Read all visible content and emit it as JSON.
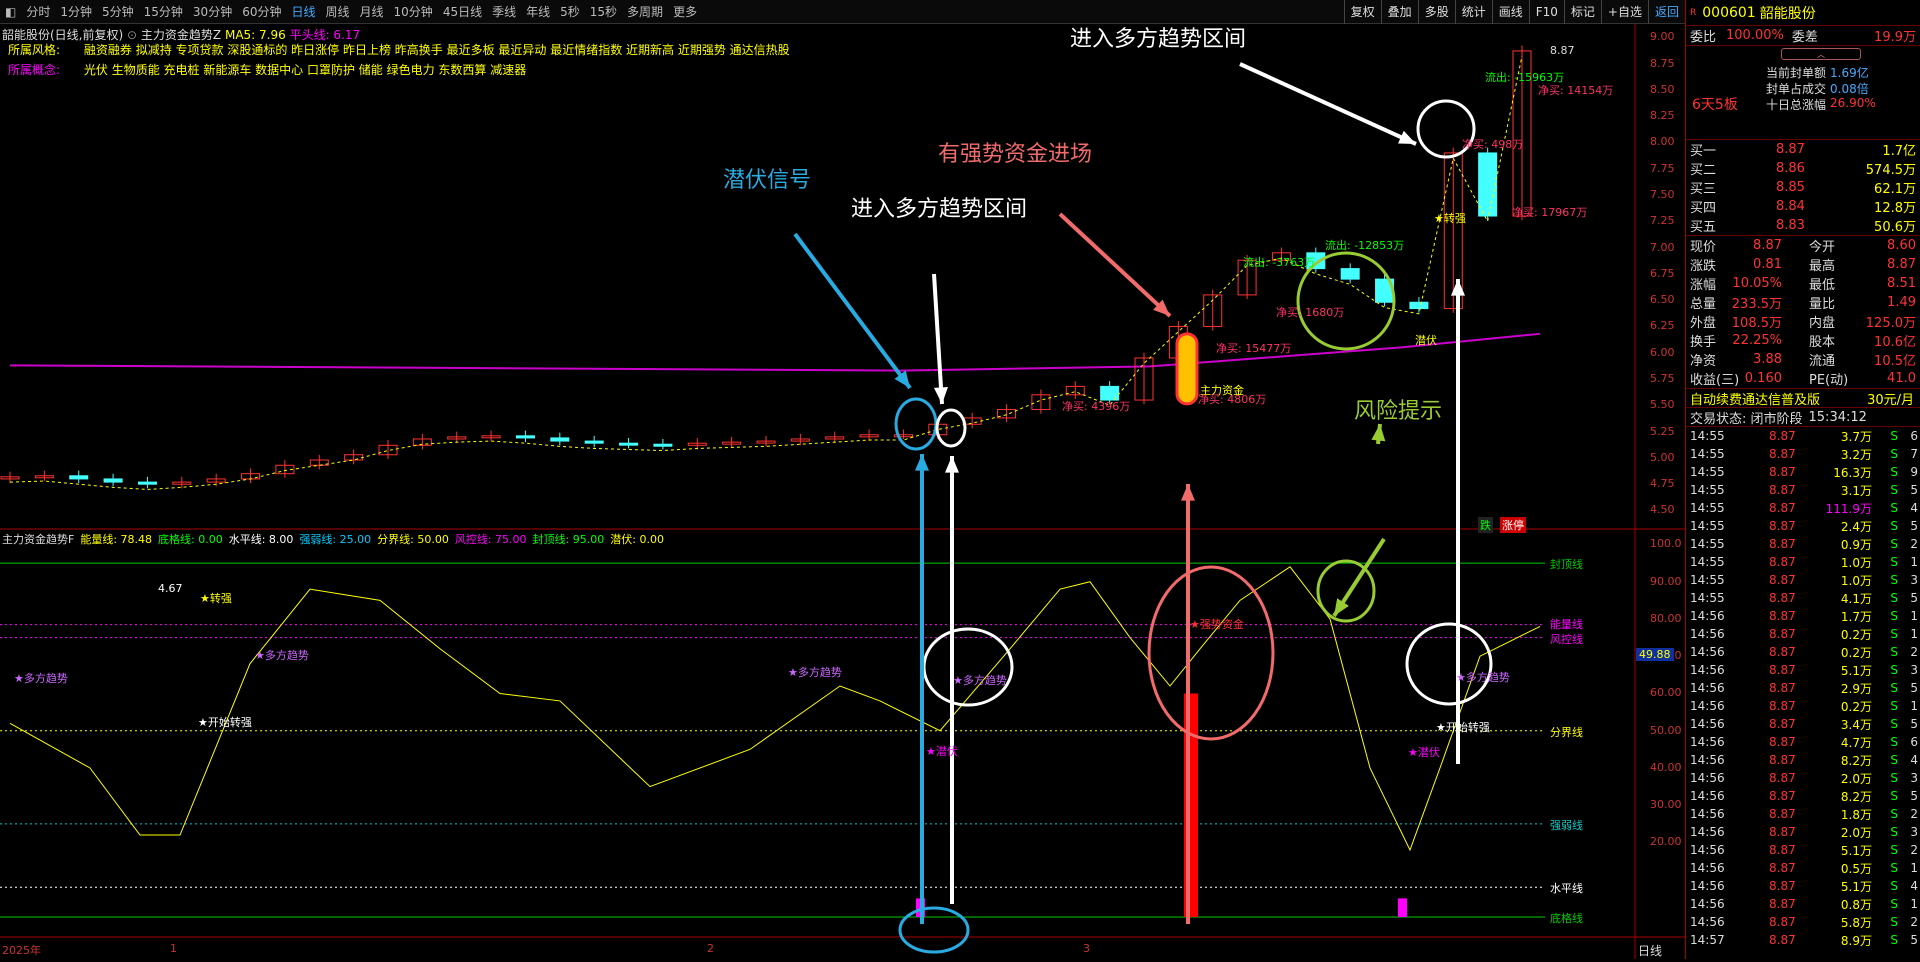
{
  "periods": [
    "分时",
    "1分钟",
    "5分钟",
    "15分钟",
    "30分钟",
    "60分钟",
    "日线",
    "周线",
    "月线",
    "10分钟",
    "45日线",
    "季线",
    "年线",
    "5秒",
    "15秒",
    "多周期",
    "更多"
  ],
  "active_period": "日线",
  "tools": [
    "复权",
    "叠加",
    "多股",
    "统计",
    "画线",
    "F10",
    "标记",
    "+自选",
    "返回"
  ],
  "main_title": "韶能股份(日线,前复权)",
  "main_indicator": "主力资金趋势Z",
  "ma5": "MA5: 7.96",
  "pingtou": "平头线: 6.17",
  "style_label": "所属风格:",
  "style_value": "融资融券 拟减持 专项贷款 深股通标的 昨日涨停 昨日上榜 昨高换手 最近多板 最近异动 最近情绪指数 近期新高 近期强势 通达信热股",
  "concept_label": "所属概念:",
  "concept_value": "光伏 生物质能 充电桩 新能源车 数据中心 口罩防护 储能 绿色电力 东数西算 减速器",
  "y_ticks_main": [
    "9.00",
    "8.75",
    "8.50",
    "8.25",
    "8.00",
    "7.75",
    "7.50",
    "7.25",
    "7.00",
    "6.75",
    "6.50",
    "6.25",
    "6.00",
    "5.75",
    "5.50",
    "5.25",
    "5.00",
    "4.75",
    "4.50"
  ],
  "y_ticks_sub": [
    "100.0",
    "90.00",
    "80.00",
    "70.00",
    "60.00",
    "50.00",
    "40.00",
    "30.00",
    "20.00"
  ],
  "sub_value_tag": "49.88",
  "sub_legend": [
    {
      "t": "主力资金趋势F",
      "c": "#ddd"
    },
    {
      "t": "能量线: 78.48",
      "c": "#ff0"
    },
    {
      "t": "底格线: 0.00",
      "c": "#0f0"
    },
    {
      "t": "水平线: 8.00",
      "c": "#fff"
    },
    {
      "t": "强弱线: 25.00",
      "c": "#0cf"
    },
    {
      "t": "分界线: 50.00",
      "c": "#ff0"
    },
    {
      "t": "风控线: 75.00",
      "c": "#f0f"
    },
    {
      "t": "封顶线: 95.00",
      "c": "#0f0"
    },
    {
      "t": "潜伏: 0.00",
      "c": "#ff0"
    }
  ],
  "sub_line_labels": [
    "封顶线",
    "能量线",
    "风控线",
    "分界线",
    "强弱线",
    "水平线",
    "底格线"
  ],
  "x_axis": [
    "2025年",
    "1",
    "2",
    "3"
  ],
  "x_axis_right": "日线",
  "annotations": [
    "进入多方趋势区间",
    "潜伏信号",
    "进入多方趋势区间",
    "有强势资金进场",
    "风险提示"
  ],
  "main_labels": [
    "4.67",
    "★转强",
    "★转强",
    "潜伏",
    "主力资金",
    "8.87"
  ],
  "flow_labels": [
    "流出: -15963万",
    "流出: -3763万",
    "流出: -12853万"
  ],
  "buy_labels": [
    "净买: 4396万",
    "净买: 15477万",
    "净买: 1680万",
    "净买: 4806万",
    "净买: 14154万",
    "净买: 17967万",
    "净买: 498万"
  ],
  "badge_labels": [
    "跌",
    "涨停"
  ],
  "sub_labels": [
    "★多方趋势",
    "★多方趋势",
    "★多方趋势",
    "★多方趋势",
    "★多方趋势",
    "★开始转强",
    "★开始转强",
    "★潜伏",
    "★潜伏",
    "★强势资金"
  ],
  "chart_data": {
    "type": "candlestick",
    "y_range": [
      4.4,
      9.05
    ],
    "sub_y_range": [
      0,
      102
    ],
    "last_close": 8.87,
    "candles": [
      4.82,
      4.83,
      4.8,
      4.77,
      4.75,
      4.77,
      4.8,
      4.85,
      4.93,
      4.98,
      5.03,
      5.12,
      5.18,
      5.2,
      5.21,
      5.19,
      5.16,
      5.14,
      5.13,
      5.12,
      5.14,
      5.15,
      5.16,
      5.18,
      5.2,
      5.22,
      5.22,
      5.32,
      5.38,
      5.46,
      5.6,
      5.68,
      5.55,
      5.95,
      6.25,
      6.55,
      6.88,
      6.95,
      6.8,
      6.7,
      6.48,
      6.42,
      7.9,
      7.3,
      8.87
    ]
  },
  "stock_code": "000601",
  "stock_name": "韶能股份",
  "wb_label": "委比",
  "wb_val": "100.00%",
  "wc_label": "委差",
  "wc_val": "19.9万",
  "feng_lines": [
    [
      "当前封单额",
      "1.69亿"
    ],
    [
      "封单占成交",
      "0.08倍"
    ],
    [
      "十日总涨幅",
      "26.90%"
    ]
  ],
  "board": "6天5板",
  "bids": [
    [
      "买一",
      "8.87",
      "1.7亿"
    ],
    [
      "买二",
      "8.86",
      "574.5万"
    ],
    [
      "买三",
      "8.85",
      "62.1万"
    ],
    [
      "买四",
      "8.84",
      "12.8万"
    ],
    [
      "买五",
      "8.83",
      "50.6万"
    ]
  ],
  "quote": [
    [
      "现价",
      "8.87",
      "今开",
      "8.60"
    ],
    [
      "涨跌",
      "0.81",
      "最高",
      "8.87"
    ],
    [
      "涨幅",
      "10.05%",
      "最低",
      "8.51"
    ],
    [
      "总量",
      "233.5万",
      "量比",
      "1.49"
    ],
    [
      "外盘",
      "108.5万",
      "内盘",
      "125.0万"
    ],
    [
      "换手",
      "22.25%",
      "股本",
      "10.6亿"
    ],
    [
      "净资",
      "3.88",
      "流通",
      "10.5亿"
    ],
    [
      "收益(三)",
      "0.160",
      "PE(动)",
      "41.0"
    ]
  ],
  "promo": "自动续费通达信普及版",
  "promo_price": "30元/月",
  "status_label": "交易状态: 闭市阶段",
  "status_time": "15:34:12",
  "ticks": [
    [
      "14:55",
      "8.87",
      "3.7万",
      "S",
      "6"
    ],
    [
      "14:55",
      "8.87",
      "3.2万",
      "S",
      "7"
    ],
    [
      "14:55",
      "8.87",
      "16.3万",
      "S",
      "9"
    ],
    [
      "14:55",
      "8.87",
      "3.1万",
      "S",
      "5"
    ],
    [
      "14:55",
      "8.87",
      "111.9万",
      "S",
      "4"
    ],
    [
      "14:55",
      "8.87",
      "2.4万",
      "S",
      "5"
    ],
    [
      "14:55",
      "8.87",
      "0.9万",
      "S",
      "2"
    ],
    [
      "14:55",
      "8.87",
      "1.0万",
      "S",
      "1"
    ],
    [
      "14:55",
      "8.87",
      "1.0万",
      "S",
      "3"
    ],
    [
      "14:55",
      "8.87",
      "4.1万",
      "S",
      "5"
    ],
    [
      "14:56",
      "8.87",
      "1.7万",
      "S",
      "1"
    ],
    [
      "14:56",
      "8.87",
      "0.2万",
      "S",
      "1"
    ],
    [
      "14:56",
      "8.87",
      "0.2万",
      "S",
      "2"
    ],
    [
      "14:56",
      "8.87",
      "5.1万",
      "S",
      "3"
    ],
    [
      "14:56",
      "8.87",
      "2.9万",
      "S",
      "5"
    ],
    [
      "14:56",
      "8.87",
      "0.2万",
      "S",
      "1"
    ],
    [
      "14:56",
      "8.87",
      "3.4万",
      "S",
      "5"
    ],
    [
      "14:56",
      "8.87",
      "4.7万",
      "S",
      "6"
    ],
    [
      "14:56",
      "8.87",
      "8.2万",
      "S",
      "4"
    ],
    [
      "14:56",
      "8.87",
      "2.0万",
      "S",
      "3"
    ],
    [
      "14:56",
      "8.87",
      "8.2万",
      "S",
      "5"
    ],
    [
      "14:56",
      "8.87",
      "1.8万",
      "S",
      "2"
    ],
    [
      "14:56",
      "8.87",
      "2.0万",
      "S",
      "3"
    ],
    [
      "14:56",
      "8.87",
      "5.1万",
      "S",
      "2"
    ],
    [
      "14:56",
      "8.87",
      "0.5万",
      "S",
      "1"
    ],
    [
      "14:56",
      "8.87",
      "5.1万",
      "S",
      "4"
    ],
    [
      "14:56",
      "8.87",
      "0.8万",
      "S",
      "1"
    ],
    [
      "14:56",
      "8.87",
      "5.8万",
      "S",
      "2"
    ],
    [
      "14:57",
      "8.87",
      "8.9万",
      "S",
      "5"
    ]
  ]
}
